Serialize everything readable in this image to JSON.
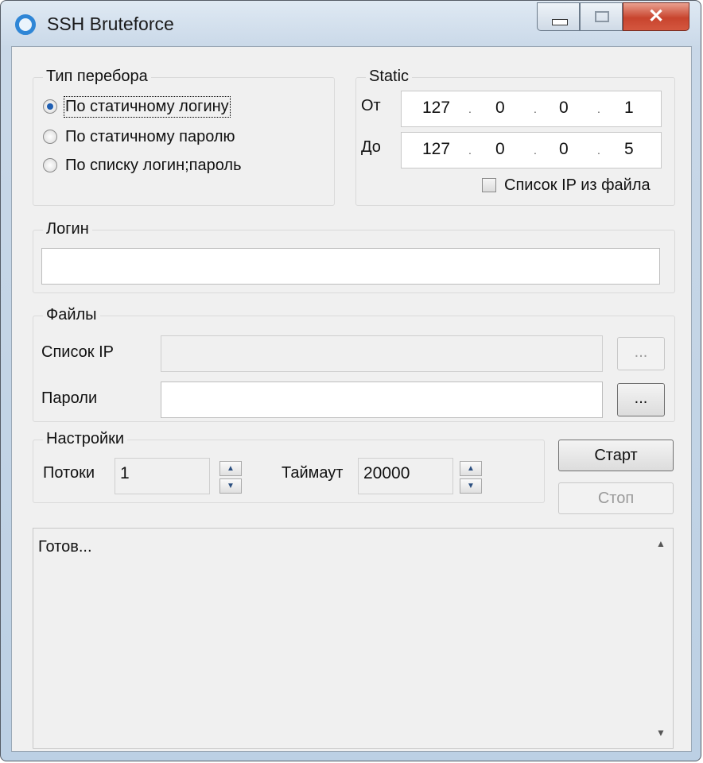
{
  "window": {
    "title": "SSH Bruteforce",
    "icon": "app-ring-icon"
  },
  "caption": {
    "minimize": "minimize-icon",
    "maximize": "maximize-icon",
    "close": "✕"
  },
  "mode_group": {
    "label": "Тип перебора",
    "options": [
      {
        "label": "По статичному логину",
        "checked": true
      },
      {
        "label": "По статичному паролю",
        "checked": false
      },
      {
        "label": "По списку логин;пароль",
        "checked": false
      }
    ]
  },
  "static_group": {
    "label": "Static",
    "from_label": "От",
    "to_label": "До",
    "from_ip": [
      "127",
      "0",
      "0",
      "1"
    ],
    "to_ip": [
      "127",
      "0",
      "0",
      "5"
    ],
    "ip_from_file_label": "Список IP из файла",
    "ip_from_file_checked": false
  },
  "login_group": {
    "label": "Логин",
    "value": ""
  },
  "files_group": {
    "label": "Файлы",
    "ip_list_label": "Список IP",
    "ip_list_value": "",
    "ip_browse": "...",
    "passwords_label": "Пароли",
    "passwords_value": "",
    "passwords_browse": "..."
  },
  "settings_group": {
    "label": "Настройки",
    "threads_label": "Потоки",
    "threads_value": "1",
    "timeout_label": "Таймаут",
    "timeout_value": "20000"
  },
  "buttons": {
    "start": "Старт",
    "stop": "Стоп"
  },
  "log": {
    "text": "Готов..."
  },
  "colors": {
    "accent": "#1f5fb3",
    "close": "#c8442e",
    "titlebar": "#c9d8e8"
  }
}
